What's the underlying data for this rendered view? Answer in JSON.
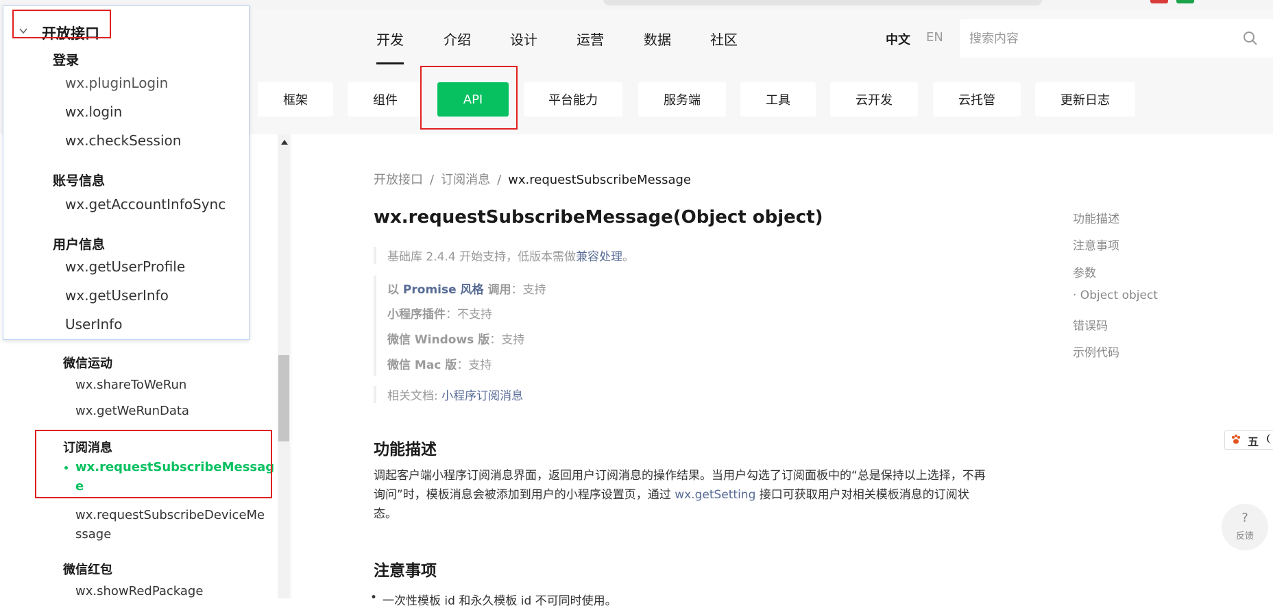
{
  "header": {
    "nav": [
      "开发",
      "介绍",
      "设计",
      "运营",
      "数据",
      "社区"
    ],
    "lang_zh": "中文",
    "lang_en": "EN",
    "search_placeholder": "搜索内容"
  },
  "subnav": {
    "tabs": [
      "框架",
      "组件",
      "API",
      "平台能力",
      "服务端",
      "工具",
      "云开发",
      "云托管",
      "更新日志"
    ],
    "active": "API"
  },
  "popup": {
    "title": "开放接口",
    "groups": [
      {
        "label": "登录",
        "items": [
          "wx.pluginLogin",
          "wx.login",
          "wx.checkSession"
        ]
      },
      {
        "label": "账号信息",
        "items": [
          "wx.getAccountInfoSync"
        ]
      },
      {
        "label": "用户信息",
        "items": [
          "wx.getUserProfile",
          "wx.getUserInfo",
          "UserInfo"
        ]
      }
    ]
  },
  "sidebar": {
    "groups": [
      {
        "label": "微信运动",
        "items": [
          "wx.shareToWeRun",
          "wx.getWeRunData"
        ]
      },
      {
        "label": "订阅消息",
        "items": [
          "wx.requestSubscribeMessag",
          "e",
          "wx.requestSubscribeDeviceMe",
          "ssage"
        ]
      },
      {
        "label": "微信红包",
        "items": [
          "wx.showRedPackage"
        ]
      }
    ]
  },
  "content": {
    "breadcrumb": [
      "开放接口",
      "订阅消息",
      "wx.requestSubscribeMessage"
    ],
    "title": "wx.requestSubscribeMessage(Object object)",
    "note_prefix": "基础库 2.4.4 开始支持，低版本需做",
    "note_link": "兼容处理",
    "note_suffix": "。",
    "support": [
      {
        "prefix": "以 ",
        "link": "Promise 风格",
        "label": " 调用",
        "value": "：支持"
      },
      {
        "prefix": "",
        "link": "",
        "label": "小程序插件",
        "value": "：不支持"
      },
      {
        "prefix": "",
        "link": "",
        "label": "微信 Windows 版",
        "value": "：支持"
      },
      {
        "prefix": "",
        "link": "",
        "label": "微信 Mac 版",
        "value": "：支持"
      }
    ],
    "related_prefix": "相关文档: ",
    "related_link": "小程序订阅消息",
    "section1": "功能描述",
    "para_part1": "调起客户端小程序订阅消息界面，返回用户订阅消息的操作结果。当用户勾选了订阅面板中的“总是保持以上选择，不再询问”时，模板消息会被添加到用户的小程序设置页，通过 ",
    "para_link": "wx.getSetting",
    "para_part2": " 接口可获取用户对相关模板消息的订阅状态。",
    "section2": "注意事项",
    "bullet1": "一次性模板 id 和永久模板 id 不可同时使用。"
  },
  "toc": [
    "功能描述",
    "注意事项",
    "参数",
    "· Object object",
    "错误码",
    "示例代码"
  ],
  "widgets": {
    "ime_five": "五",
    "feedback_q": "?",
    "feedback_label": "反馈"
  },
  "colors": {
    "accent": "#07c160",
    "link": "#576b95",
    "highlight_box": "#e02020"
  }
}
